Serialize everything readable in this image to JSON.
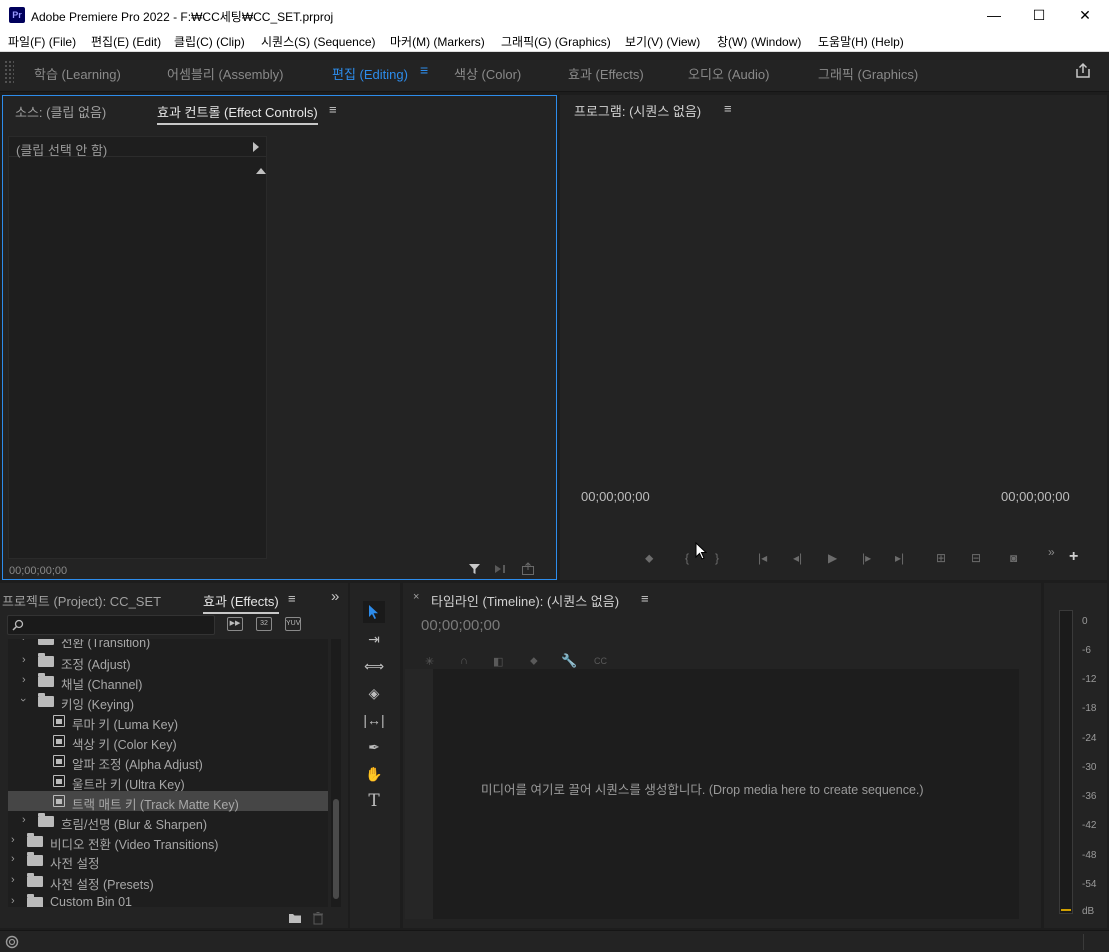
{
  "window": {
    "app_icon": "Pr",
    "title": "Adobe Premiere Pro 2022 - F:₩CC세팅₩CC_SET.prproj",
    "controls": {
      "minimize": "—",
      "maximize": "☐",
      "close": "✕"
    }
  },
  "menu": [
    "파일(F) (File)",
    "편집(E) (Edit)",
    "클립(C) (Clip)",
    "시퀀스(S) (Sequence)",
    "마커(M) (Markers)",
    "그래픽(G) (Graphics)",
    "보기(V) (View)",
    "창(W) (Window)",
    "도움말(H) (Help)"
  ],
  "workspaces": {
    "tabs": [
      "학습 (Learning)",
      "어셈블리 (Assembly)",
      "편집 (Editing)",
      "색상 (Color)",
      "효과 (Effects)",
      "오디오 (Audio)",
      "그래픽 (Graphics)"
    ],
    "active": "편집 (Editing)",
    "menu_icon": "≡"
  },
  "source_panel": {
    "tab_source": "소스: (클립 없음)",
    "tab_effect_controls": "효과 컨트롤 (Effect Controls)",
    "menu_icon": "≡",
    "no_clip": "(클립 선택 안 함)",
    "timecode": "00;00;00;00"
  },
  "program_panel": {
    "tab": "프로그램: (시퀀스 없음)",
    "menu_icon": "≡",
    "timecode_left": "00;00;00;00",
    "timecode_right": "00;00;00;00"
  },
  "effects_panel": {
    "tab_project": "프로젝트 (Project): CC_SET",
    "tab_effects": "효과 (Effects)",
    "menu_icon": "≡",
    "overflow_icon": "»",
    "filter_buttons": [
      "▶▶",
      "32",
      "YUV"
    ],
    "tree": [
      {
        "label": "전환 (Transition)",
        "kind": "folder",
        "indent": 1,
        "expanded": false
      },
      {
        "label": "조정 (Adjust)",
        "kind": "folder",
        "indent": 1,
        "expanded": false
      },
      {
        "label": "채널 (Channel)",
        "kind": "folder",
        "indent": 1,
        "expanded": false
      },
      {
        "label": "키잉 (Keying)",
        "kind": "folder",
        "indent": 1,
        "expanded": true
      },
      {
        "label": "루마 키 (Luma Key)",
        "kind": "effect",
        "indent": 2
      },
      {
        "label": "색상 키 (Color Key)",
        "kind": "effect",
        "indent": 2
      },
      {
        "label": "알파 조정 (Alpha Adjust)",
        "kind": "effect",
        "indent": 2
      },
      {
        "label": "울트라 키 (Ultra Key)",
        "kind": "effect",
        "indent": 2
      },
      {
        "label": "트랙 매트 키 (Track Matte Key)",
        "kind": "effect",
        "indent": 2,
        "selected": true
      },
      {
        "label": "흐림/선명 (Blur & Sharpen)",
        "kind": "folder",
        "indent": 1,
        "expanded": false
      },
      {
        "label": "비디오 전환 (Video Transitions)",
        "kind": "folder",
        "indent": 0,
        "expanded": false
      },
      {
        "label": "사전 설정",
        "kind": "preset-folder",
        "indent": 0,
        "expanded": false
      },
      {
        "label": "사전 설정 (Presets)",
        "kind": "preset-folder",
        "indent": 0,
        "expanded": false
      },
      {
        "label": "Custom Bin 01",
        "kind": "folder",
        "indent": 0,
        "expanded": false
      }
    ]
  },
  "tools": [
    "select-tool",
    "track-select-tool",
    "ripple-edit-tool",
    "razor-tool",
    "slip-tool",
    "pen-tool",
    "hand-tool",
    "type-tool"
  ],
  "timeline": {
    "close_icon": "×",
    "tab": "타임라인 (Timeline): (시퀀스 없음)",
    "menu_icon": "≡",
    "timecode": "00;00;00;00",
    "drop_hint": "미디어를 여기로 끌어 시퀀스를 생성합니다. (Drop media here to create sequence.)"
  },
  "audio_meter": {
    "labels": [
      "0",
      "-6",
      "-12",
      "-18",
      "-24",
      "-30",
      "-36",
      "-42",
      "-48",
      "-54",
      "dB"
    ]
  },
  "colors": {
    "accent": "#2d8ceb",
    "panel_bg": "#232323",
    "selected_row": "#464646"
  }
}
